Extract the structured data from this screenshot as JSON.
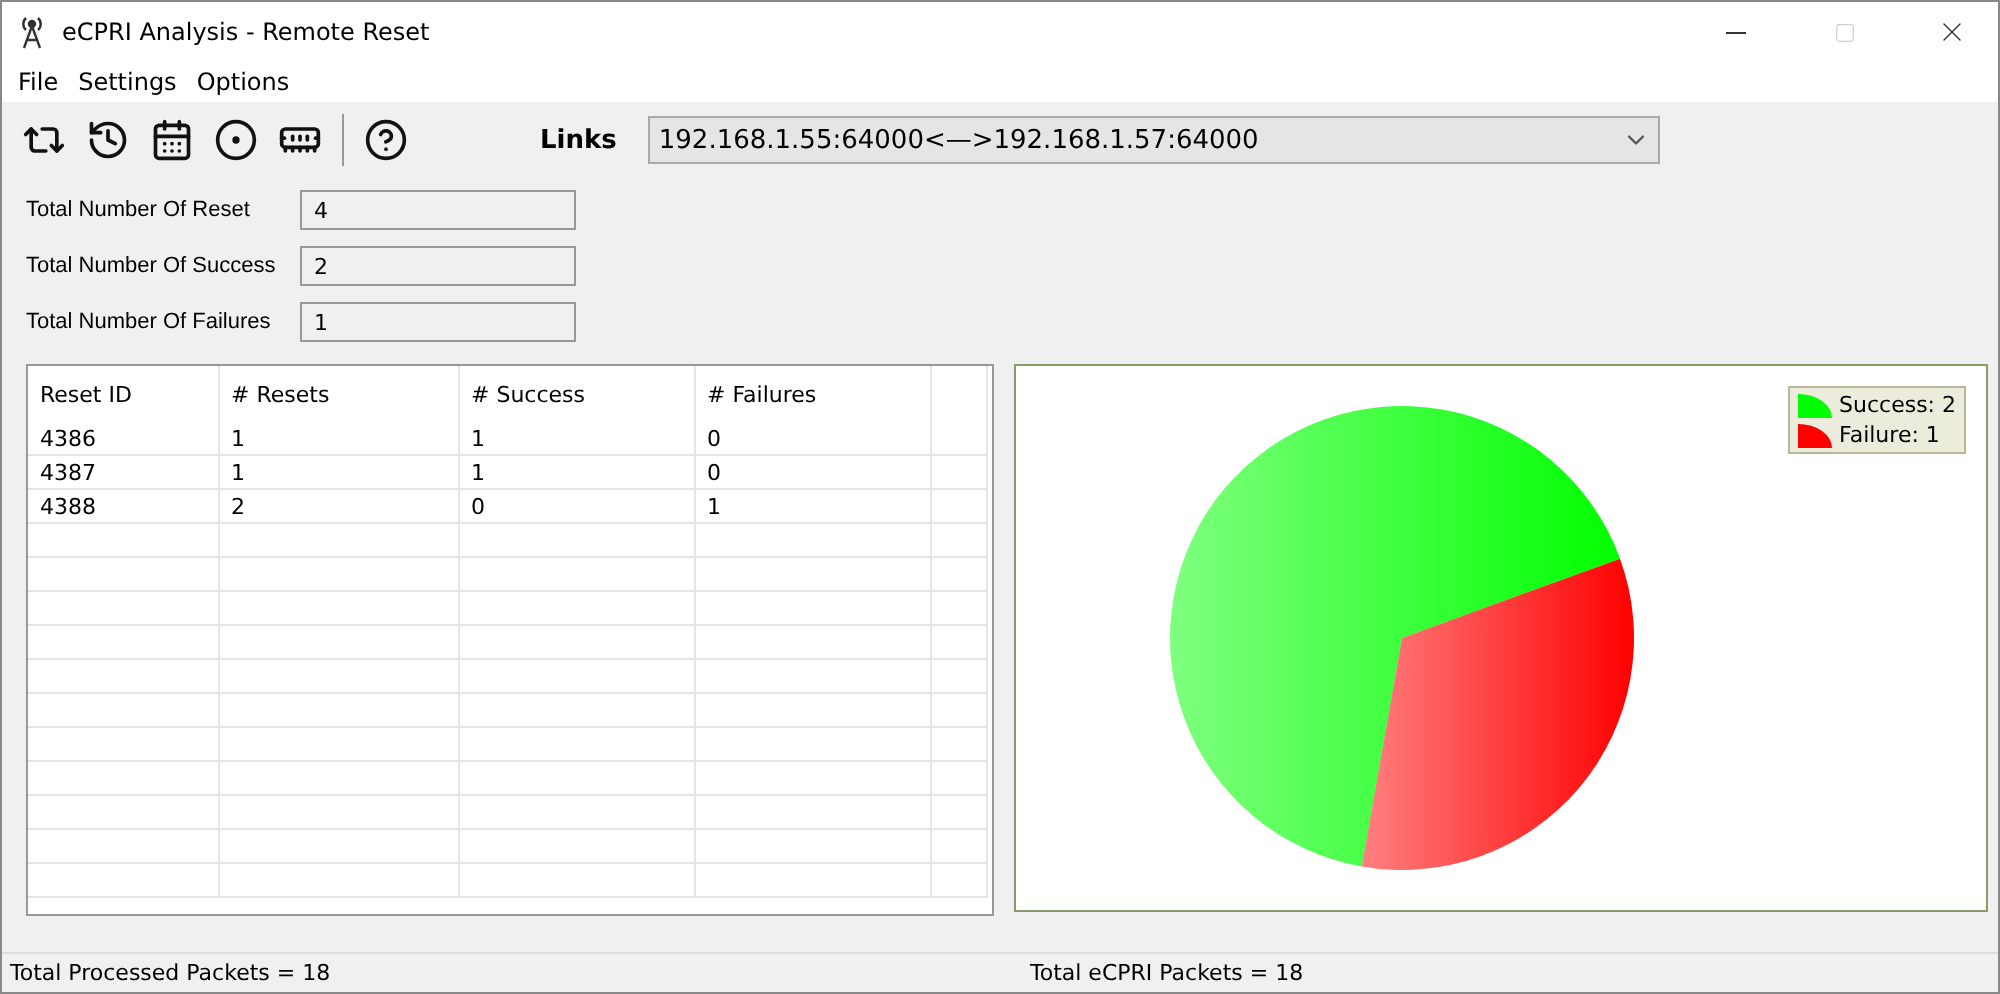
{
  "window": {
    "title": "eCPRI Analysis - Remote Reset"
  },
  "menu": [
    "File",
    "Settings",
    "Options"
  ],
  "toolbar": [
    {
      "kind": "swap"
    },
    {
      "kind": "history"
    },
    {
      "kind": "calendar"
    },
    {
      "kind": "disc"
    },
    {
      "kind": "card"
    },
    {
      "kind": "help"
    }
  ],
  "links": {
    "label": "Links",
    "value": "192.168.1.55:64000<—>192.168.1.57:64000"
  },
  "stats": [
    {
      "label": "Total Number Of Reset",
      "value": "4"
    },
    {
      "label": "Total Number Of Success",
      "value": "2"
    },
    {
      "label": "Total Number Of Failures",
      "value": "1"
    }
  ],
  "table": {
    "columns": [
      "Reset ID",
      "# Resets",
      "# Success",
      "# Failures"
    ],
    "rows": [
      [
        "4386",
        "1",
        "1",
        "0"
      ],
      [
        "4387",
        "1",
        "1",
        "0"
      ],
      [
        "4388",
        "2",
        "0",
        "1"
      ]
    ]
  },
  "chart_data": {
    "type": "pie",
    "categories": [
      "Success: 2",
      "Failure: 1"
    ],
    "values": [
      2,
      1
    ],
    "colors": [
      "#00ff00",
      "#ff0000"
    ]
  },
  "status_bar": [
    "Total Processed Packets = 18",
    "Total eCPRI Packets = 18"
  ]
}
